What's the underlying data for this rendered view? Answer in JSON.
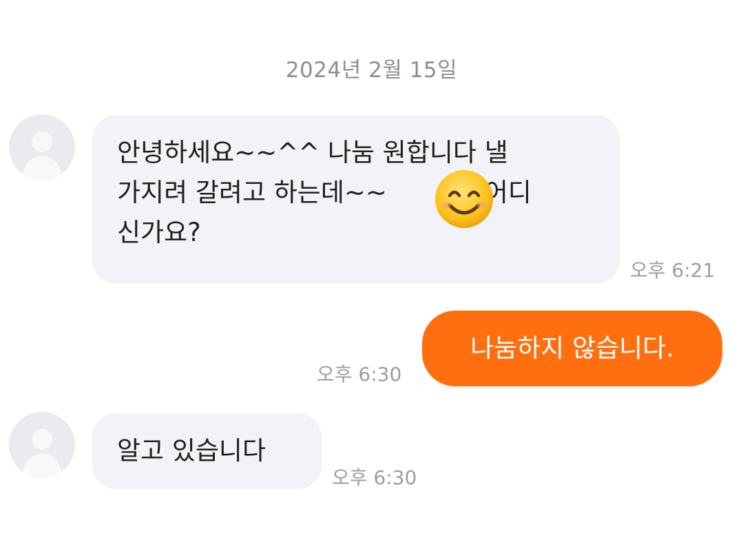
{
  "chat": {
    "date_divider": "2024년 2월 15일",
    "messages": [
      {
        "direction": "incoming",
        "lines": [
          "안녕하세요~~^^ 나눔 원합니다 낼",
          "가지려 갈려고 하는데~~",
          "신가요?"
        ],
        "inline_after_emoji": "동 어디",
        "time": "오후 6:21"
      },
      {
        "direction": "outgoing",
        "text": "나눔하지 않습니다.",
        "time": "오후 6:30"
      },
      {
        "direction": "incoming",
        "text": "알고 있습니다",
        "time": "오후 6:30"
      }
    ]
  },
  "icons": {
    "avatar": "default-user-avatar-icon",
    "emoji": "smiling-face-emoji"
  },
  "colors": {
    "outgoing_bubble": "#ff6f0f",
    "incoming_bubble": "#f2f3f6",
    "timestamp": "#9a9da2",
    "avatar_bg": "#e9ebee"
  }
}
